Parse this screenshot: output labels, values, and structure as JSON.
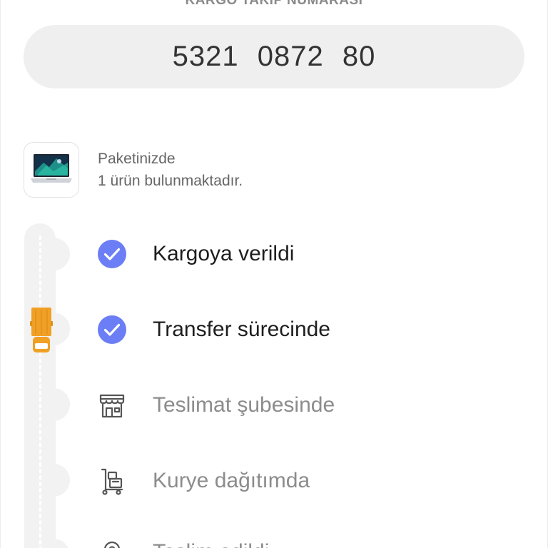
{
  "tracking": {
    "label": "KARGO TAKİP NUMARASI",
    "number": "5321  0872  80"
  },
  "package": {
    "line1": "Paketinizde",
    "line2": "1 ürün bulunmaktadır."
  },
  "steps": [
    {
      "label": "Kargoya verildi",
      "status": "done",
      "icon": "check-circle-icon"
    },
    {
      "label": "Transfer sürecinde",
      "status": "done",
      "icon": "check-circle-icon"
    },
    {
      "label": "Teslimat şubesinde",
      "status": "pending",
      "icon": "storefront-icon"
    },
    {
      "label": "Kurye dağıtımda",
      "status": "pending",
      "icon": "courier-trolley-icon"
    },
    {
      "label": "Teslim edildi",
      "status": "pending",
      "icon": "location-pin-icon"
    }
  ],
  "colors": {
    "accent": "#6b7ef5",
    "truck": "#f0a024",
    "track": "#f2f2f2",
    "pill": "#efefef"
  }
}
